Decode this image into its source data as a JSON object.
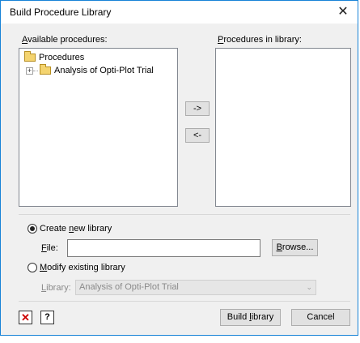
{
  "window": {
    "title": "Build Procedure Library",
    "close_glyph": "✕"
  },
  "available": {
    "label": "Available procedures:",
    "label_accel": "A",
    "label_rest": "vailable procedures:",
    "tree": [
      {
        "label": "Procedures",
        "icon": "folder-icon"
      },
      {
        "label": "Analysis of Opti-Plot Trial",
        "icon": "folder-icon",
        "expander": "+"
      }
    ]
  },
  "library": {
    "label_accel": "P",
    "label_rest": "rocedures in library:"
  },
  "transfer": {
    "add_label": "->",
    "remove_label": "<-"
  },
  "create": {
    "label_pre": "Create ",
    "label_accel": "n",
    "label_post": "ew library",
    "selected": true,
    "file_label_accel": "F",
    "file_label_rest": "ile:",
    "file_value": "",
    "browse_label_accel": "B",
    "browse_label_rest": "rowse..."
  },
  "modify": {
    "label_accel": "M",
    "label_rest": "odify existing library",
    "selected": false,
    "library_label_accel": "L",
    "library_label_rest": "ibrary:",
    "library_value": "Analysis of Opti-Plot Trial"
  },
  "footer": {
    "clear_glyph": "✕",
    "help_glyph": "?",
    "build_pre": "Build ",
    "build_accel": "l",
    "build_post": "ibrary",
    "cancel_label": "Cancel"
  },
  "colors": {
    "accent": "#1883d7",
    "dialog_bg": "#f0f0f0",
    "clear_red": "#cc0000"
  }
}
